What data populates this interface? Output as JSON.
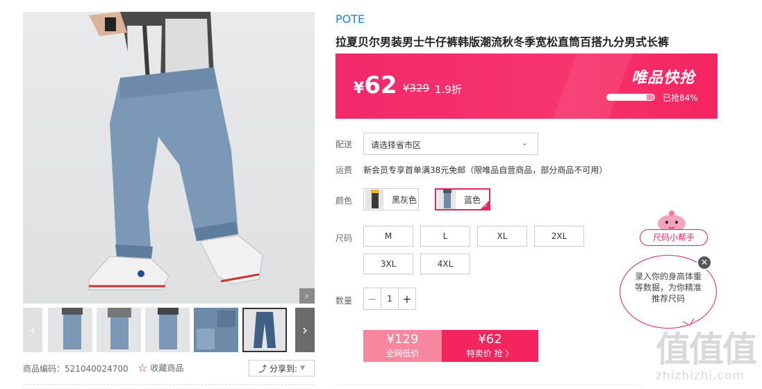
{
  "gallery": {
    "zoom_icon": "magnifier-icon",
    "thumb_prev": "‹",
    "thumb_next": "›",
    "product_code": "商品编码：521040024700",
    "favorite_label": "收藏商品",
    "share_label": "分享到:"
  },
  "product": {
    "brand": "POTE",
    "title": "拉夏贝尔男装男士牛仔裤韩版潮流秋冬季宽松直筒百搭九分男式长裤"
  },
  "price_banner": {
    "currency": "¥",
    "price": "62",
    "original_price": "329",
    "discount": "1.9折",
    "flash_label": "唯品快抢",
    "sold_percent": 84,
    "sold_text": "已抢84%"
  },
  "delivery": {
    "label": "配送",
    "placeholder": "请选择省市区"
  },
  "shipping": {
    "label": "运费",
    "text": "新会员专享首单满38元免邮（限唯品自营商品，部分商品不可用）"
  },
  "colors": {
    "label": "颜色",
    "options": [
      {
        "name": "黑灰色",
        "selected": false
      },
      {
        "name": "蓝色",
        "selected": true
      }
    ]
  },
  "sizes": {
    "label": "尺码",
    "options": [
      "M",
      "L",
      "XL",
      "2XL",
      "3XL",
      "4XL"
    ]
  },
  "quantity": {
    "label": "数量",
    "value": "1",
    "minus": "−",
    "plus": "+"
  },
  "buy": {
    "left_price": "¥129",
    "left_text": "全网低价",
    "right_price": "¥62",
    "right_text": "特卖价 抢 〉"
  },
  "size_helper": {
    "tag": "尺码小帮手",
    "message": "录入你的身高体重等数据，为你精准推荐尺码",
    "close": "✕"
  },
  "watermark": {
    "big": "值值值",
    "small": "zhizhizhi.com"
  },
  "colors_theme": {
    "accent": "#f4245f",
    "brand_blue": "#1c7fd6"
  }
}
